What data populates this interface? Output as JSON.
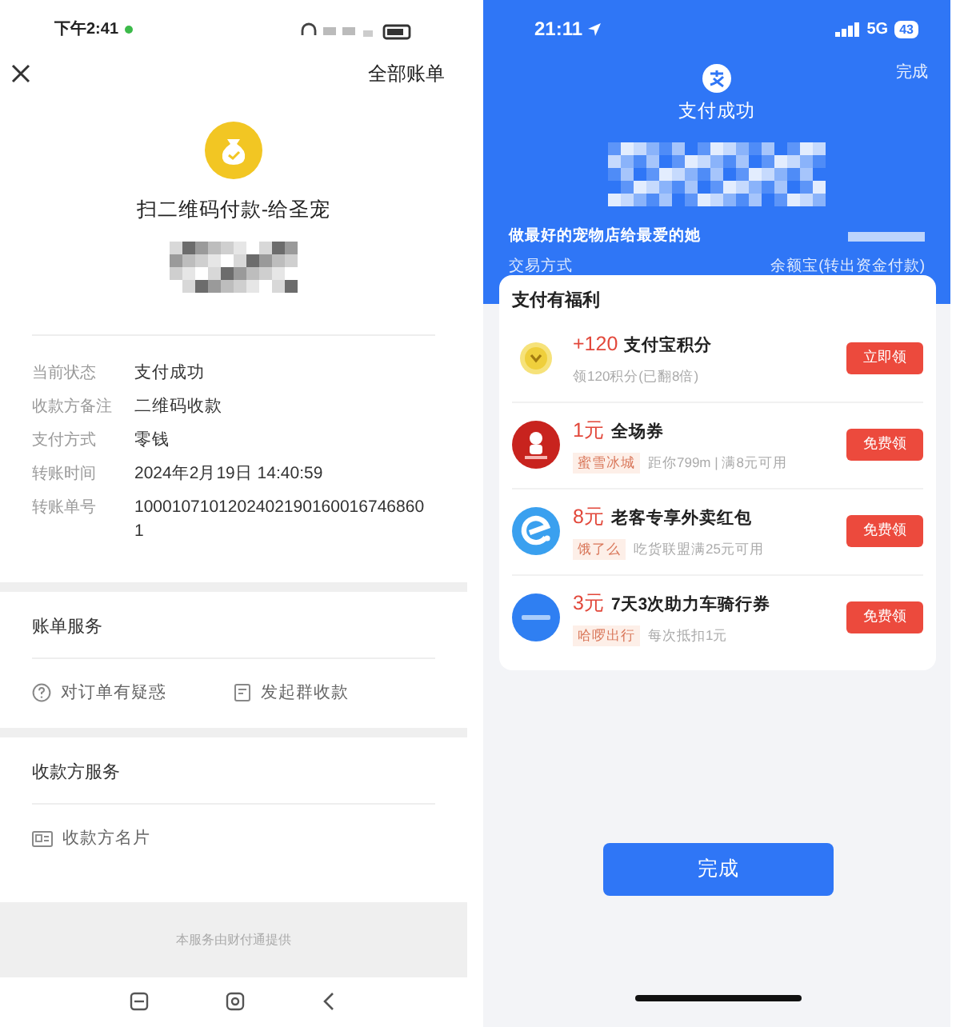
{
  "left_screen": {
    "status_bar": {
      "time": "下午2:41"
    },
    "header": {
      "action": "全部账单"
    },
    "title": "扫二维码付款-给圣宠",
    "details": [
      {
        "label": "当前状态",
        "value": "支付成功"
      },
      {
        "label": "收款方备注",
        "value": "二维码收款"
      },
      {
        "label": "支付方式",
        "value": "零钱"
      },
      {
        "label": "转账时间",
        "value": "2024年2月19日 14:40:59"
      },
      {
        "label": "转账单号",
        "value": "10001071012024021901600167468601"
      }
    ],
    "sections": [
      {
        "title": "账单服务",
        "items": [
          {
            "kind": "question",
            "label": "对订单有疑惑"
          },
          {
            "kind": "document",
            "label": "发起群收款"
          }
        ]
      },
      {
        "title": "收款方服务",
        "items": [
          {
            "kind": "card",
            "label": "收款方名片"
          }
        ]
      }
    ],
    "footer": "本服务由财付通提供"
  },
  "right_screen": {
    "status_bar": {
      "time": "21:11",
      "network": "5G",
      "battery": "43"
    },
    "done_link": "完成",
    "status": "支付成功",
    "merchant": "做最好的宠物店给最爱的她",
    "rows": [
      {
        "label": "交易方式",
        "value": "余额宝(转出资金付款)"
      }
    ],
    "benefits": {
      "title": "支付有福利",
      "items": [
        {
          "kind": "coin",
          "amount": "+120",
          "title": "支付宝积分",
          "desc": "领120积分(已翻8倍)",
          "button": "立即领"
        },
        {
          "kind": "dessert",
          "amount": "1元",
          "title": "全场券",
          "tag": "蜜雪冰城",
          "desc": "距你799m | 满8元可用",
          "button": "免费领"
        },
        {
          "kind": "swirl",
          "amount": "8元",
          "title": "老客专享外卖红包",
          "tag": "饿了么",
          "desc": "吃货联盟满25元可用",
          "button": "免费领"
        },
        {
          "kind": "bike",
          "amount": "3元",
          "title": "7天3次助力车骑行券",
          "tag": "哈啰出行",
          "desc": "每次抵扣1元",
          "button": "免费领"
        }
      ]
    },
    "done_button": "完成"
  }
}
